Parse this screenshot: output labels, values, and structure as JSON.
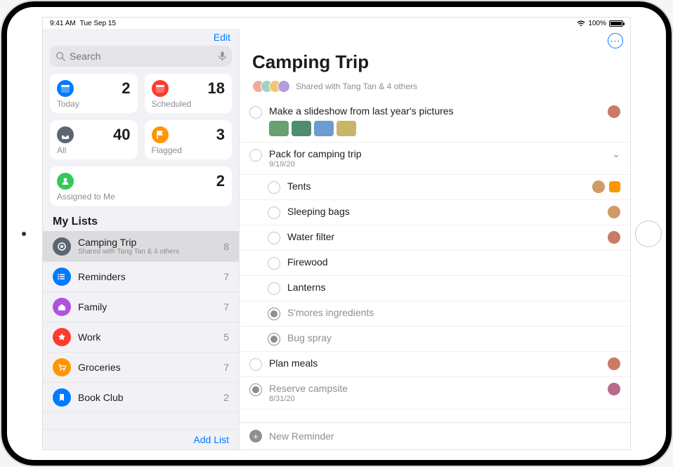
{
  "status": {
    "time": "9:41 AM",
    "date": "Tue Sep 15",
    "battery": "100%"
  },
  "sidebar": {
    "edit": "Edit",
    "search_placeholder": "Search",
    "smart": {
      "today": {
        "label": "Today",
        "count": "2",
        "color": "#007aff"
      },
      "scheduled": {
        "label": "Scheduled",
        "count": "18",
        "color": "#ff3b30"
      },
      "all": {
        "label": "All",
        "count": "40",
        "color": "#5b6670"
      },
      "flagged": {
        "label": "Flagged",
        "count": "3",
        "color": "#ff9500"
      },
      "assigned": {
        "label": "Assigned to Me",
        "count": "2",
        "color": "#34c759"
      }
    },
    "section": "My Lists",
    "lists": [
      {
        "name": "Camping Trip",
        "subtitle": "Shared with Tang Tan & 4 others",
        "count": "8",
        "color": "#5b6670",
        "selected": true,
        "icon": "target"
      },
      {
        "name": "Reminders",
        "subtitle": "",
        "count": "7",
        "color": "#007aff",
        "selected": false,
        "icon": "list"
      },
      {
        "name": "Family",
        "subtitle": "",
        "count": "7",
        "color": "#af52de",
        "selected": false,
        "icon": "home"
      },
      {
        "name": "Work",
        "subtitle": "",
        "count": "5",
        "color": "#ff3b30",
        "selected": false,
        "icon": "star"
      },
      {
        "name": "Groceries",
        "subtitle": "",
        "count": "7",
        "color": "#ff9500",
        "selected": false,
        "icon": "cart"
      },
      {
        "name": "Book Club",
        "subtitle": "",
        "count": "2",
        "color": "#007aff",
        "selected": false,
        "icon": "bookmark"
      }
    ],
    "add_list": "Add List"
  },
  "detail": {
    "title": "Camping Trip",
    "shared_text": "Shared with Tang Tan & 4 others",
    "shared_avatars": [
      "#f4a9a0",
      "#9ed3c1",
      "#f0c674",
      "#b39ddb"
    ],
    "reminders": [
      {
        "title": "Make a slideshow from last year's pictures",
        "done": false,
        "sub": "",
        "assignee": "#c97b63",
        "flagged": false,
        "indent": 0,
        "thumbs": [
          "#6aa06e",
          "#4f8d6e",
          "#6b9bd1",
          "#c9b46a"
        ],
        "expandable": false
      },
      {
        "title": "Pack for camping trip",
        "done": false,
        "sub": "9/19/20",
        "assignee": "",
        "flagged": false,
        "indent": 0,
        "expandable": true
      },
      {
        "title": "Tents",
        "done": false,
        "sub": "",
        "assignee": "#d19a66",
        "flagged": true,
        "indent": 1
      },
      {
        "title": "Sleeping bags",
        "done": false,
        "sub": "",
        "assignee": "#d19a66",
        "flagged": false,
        "indent": 1
      },
      {
        "title": "Water filter",
        "done": false,
        "sub": "",
        "assignee": "#c97b63",
        "flagged": false,
        "indent": 1
      },
      {
        "title": "Firewood",
        "done": false,
        "sub": "",
        "assignee": "",
        "flagged": false,
        "indent": 1
      },
      {
        "title": "Lanterns",
        "done": false,
        "sub": "",
        "assignee": "",
        "flagged": false,
        "indent": 1
      },
      {
        "title": "S'mores ingredients",
        "done": true,
        "sub": "",
        "assignee": "",
        "flagged": false,
        "indent": 1
      },
      {
        "title": "Bug spray",
        "done": true,
        "sub": "",
        "assignee": "",
        "flagged": false,
        "indent": 1
      },
      {
        "title": "Plan meals",
        "done": false,
        "sub": "",
        "assignee": "#c97b63",
        "flagged": false,
        "indent": 0
      },
      {
        "title": "Reserve campsite",
        "done": true,
        "sub": "8/31/20",
        "assignee": "#b86b8a",
        "flagged": false,
        "indent": 0
      }
    ],
    "new_reminder": "New Reminder"
  }
}
